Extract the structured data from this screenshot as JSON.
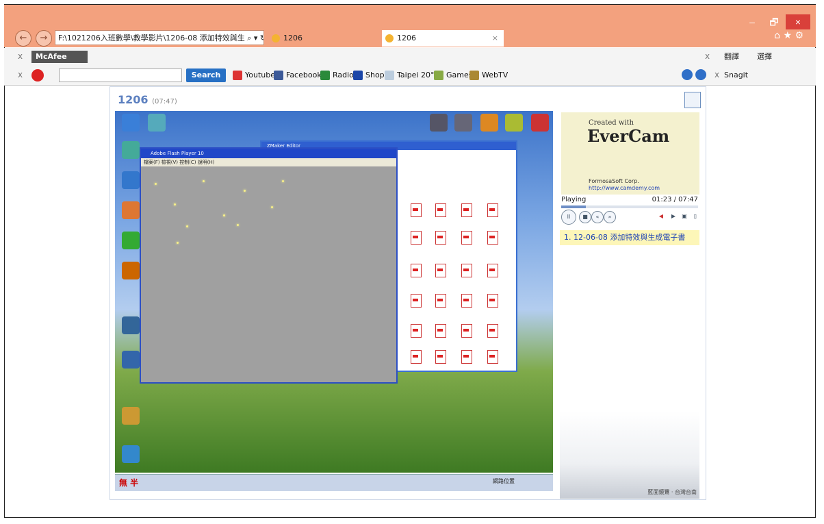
{
  "window": {
    "minimize": "–",
    "restore": "🗗",
    "close": "×",
    "top_right_icons": "⌂ ★ ⚙"
  },
  "browser": {
    "back": "←",
    "forward": "→",
    "address": "F:\\1021206入班數學\\教學影片\\1206-08 添加特效與生 ⌕ ▾ ↻",
    "tabs": [
      {
        "label": "1206",
        "active": false
      },
      {
        "label": "1206",
        "active": true,
        "close": "×"
      }
    ]
  },
  "toolbar1": {
    "close": "x",
    "mcafee": "McAfee",
    "right_close": "x",
    "right_items": [
      "翻譯",
      "選擇"
    ]
  },
  "toolbar2": {
    "close": "x",
    "search_placeholder": "",
    "search_button": "Search",
    "links": [
      "Youtube",
      "Facebook",
      "Radio",
      "Shop",
      "Taipei 20°C",
      "Games",
      "WebTV"
    ],
    "right_close": "x",
    "snagit": "Snagit"
  },
  "page": {
    "title": "1206",
    "duration": "(07:47)"
  },
  "recording": {
    "flash_title": "Adobe Flash Player 10",
    "flash_menu": "檔案(F)  檢視(V)  控制(C)  說明(H)",
    "explorer_title": "ZMaker Editor",
    "taskbar_label": "網路位置"
  },
  "evercam": {
    "created": "Created with",
    "brand": "EverCam",
    "company": "FormosaSoft Corp.",
    "url": "http://www.camdemy.com"
  },
  "player": {
    "status": "Playing",
    "time": "01:23 / 07:47",
    "progress": 0.18
  },
  "playlist": [
    {
      "label": "1. 12-06-08 添加特效與生成電子書"
    }
  ],
  "scenery_caption": "藍面鏡鷺 · 台灣台南"
}
